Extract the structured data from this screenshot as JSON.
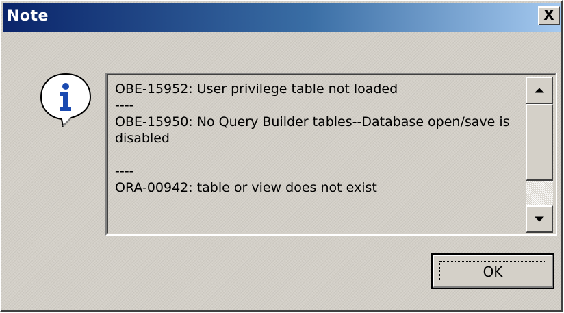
{
  "window": {
    "title": "Note",
    "close_label": "X"
  },
  "dialog": {
    "icon": "info-icon",
    "message": "OBE-15952: User privilege table not loaded\n----\nOBE-15950: No Query Builder tables--Database open/save is disabled\n\n----\nORA-00942: table or view does not exist",
    "ok_label": "OK"
  },
  "scrollbar": {
    "up_icon": "arrow-up-icon",
    "down_icon": "arrow-down-icon"
  },
  "colors": {
    "titlebar_start": "#0a246a",
    "titlebar_end": "#a6caf0",
    "face": "#d4d0c8",
    "info_blue": "#1a4ab0"
  }
}
